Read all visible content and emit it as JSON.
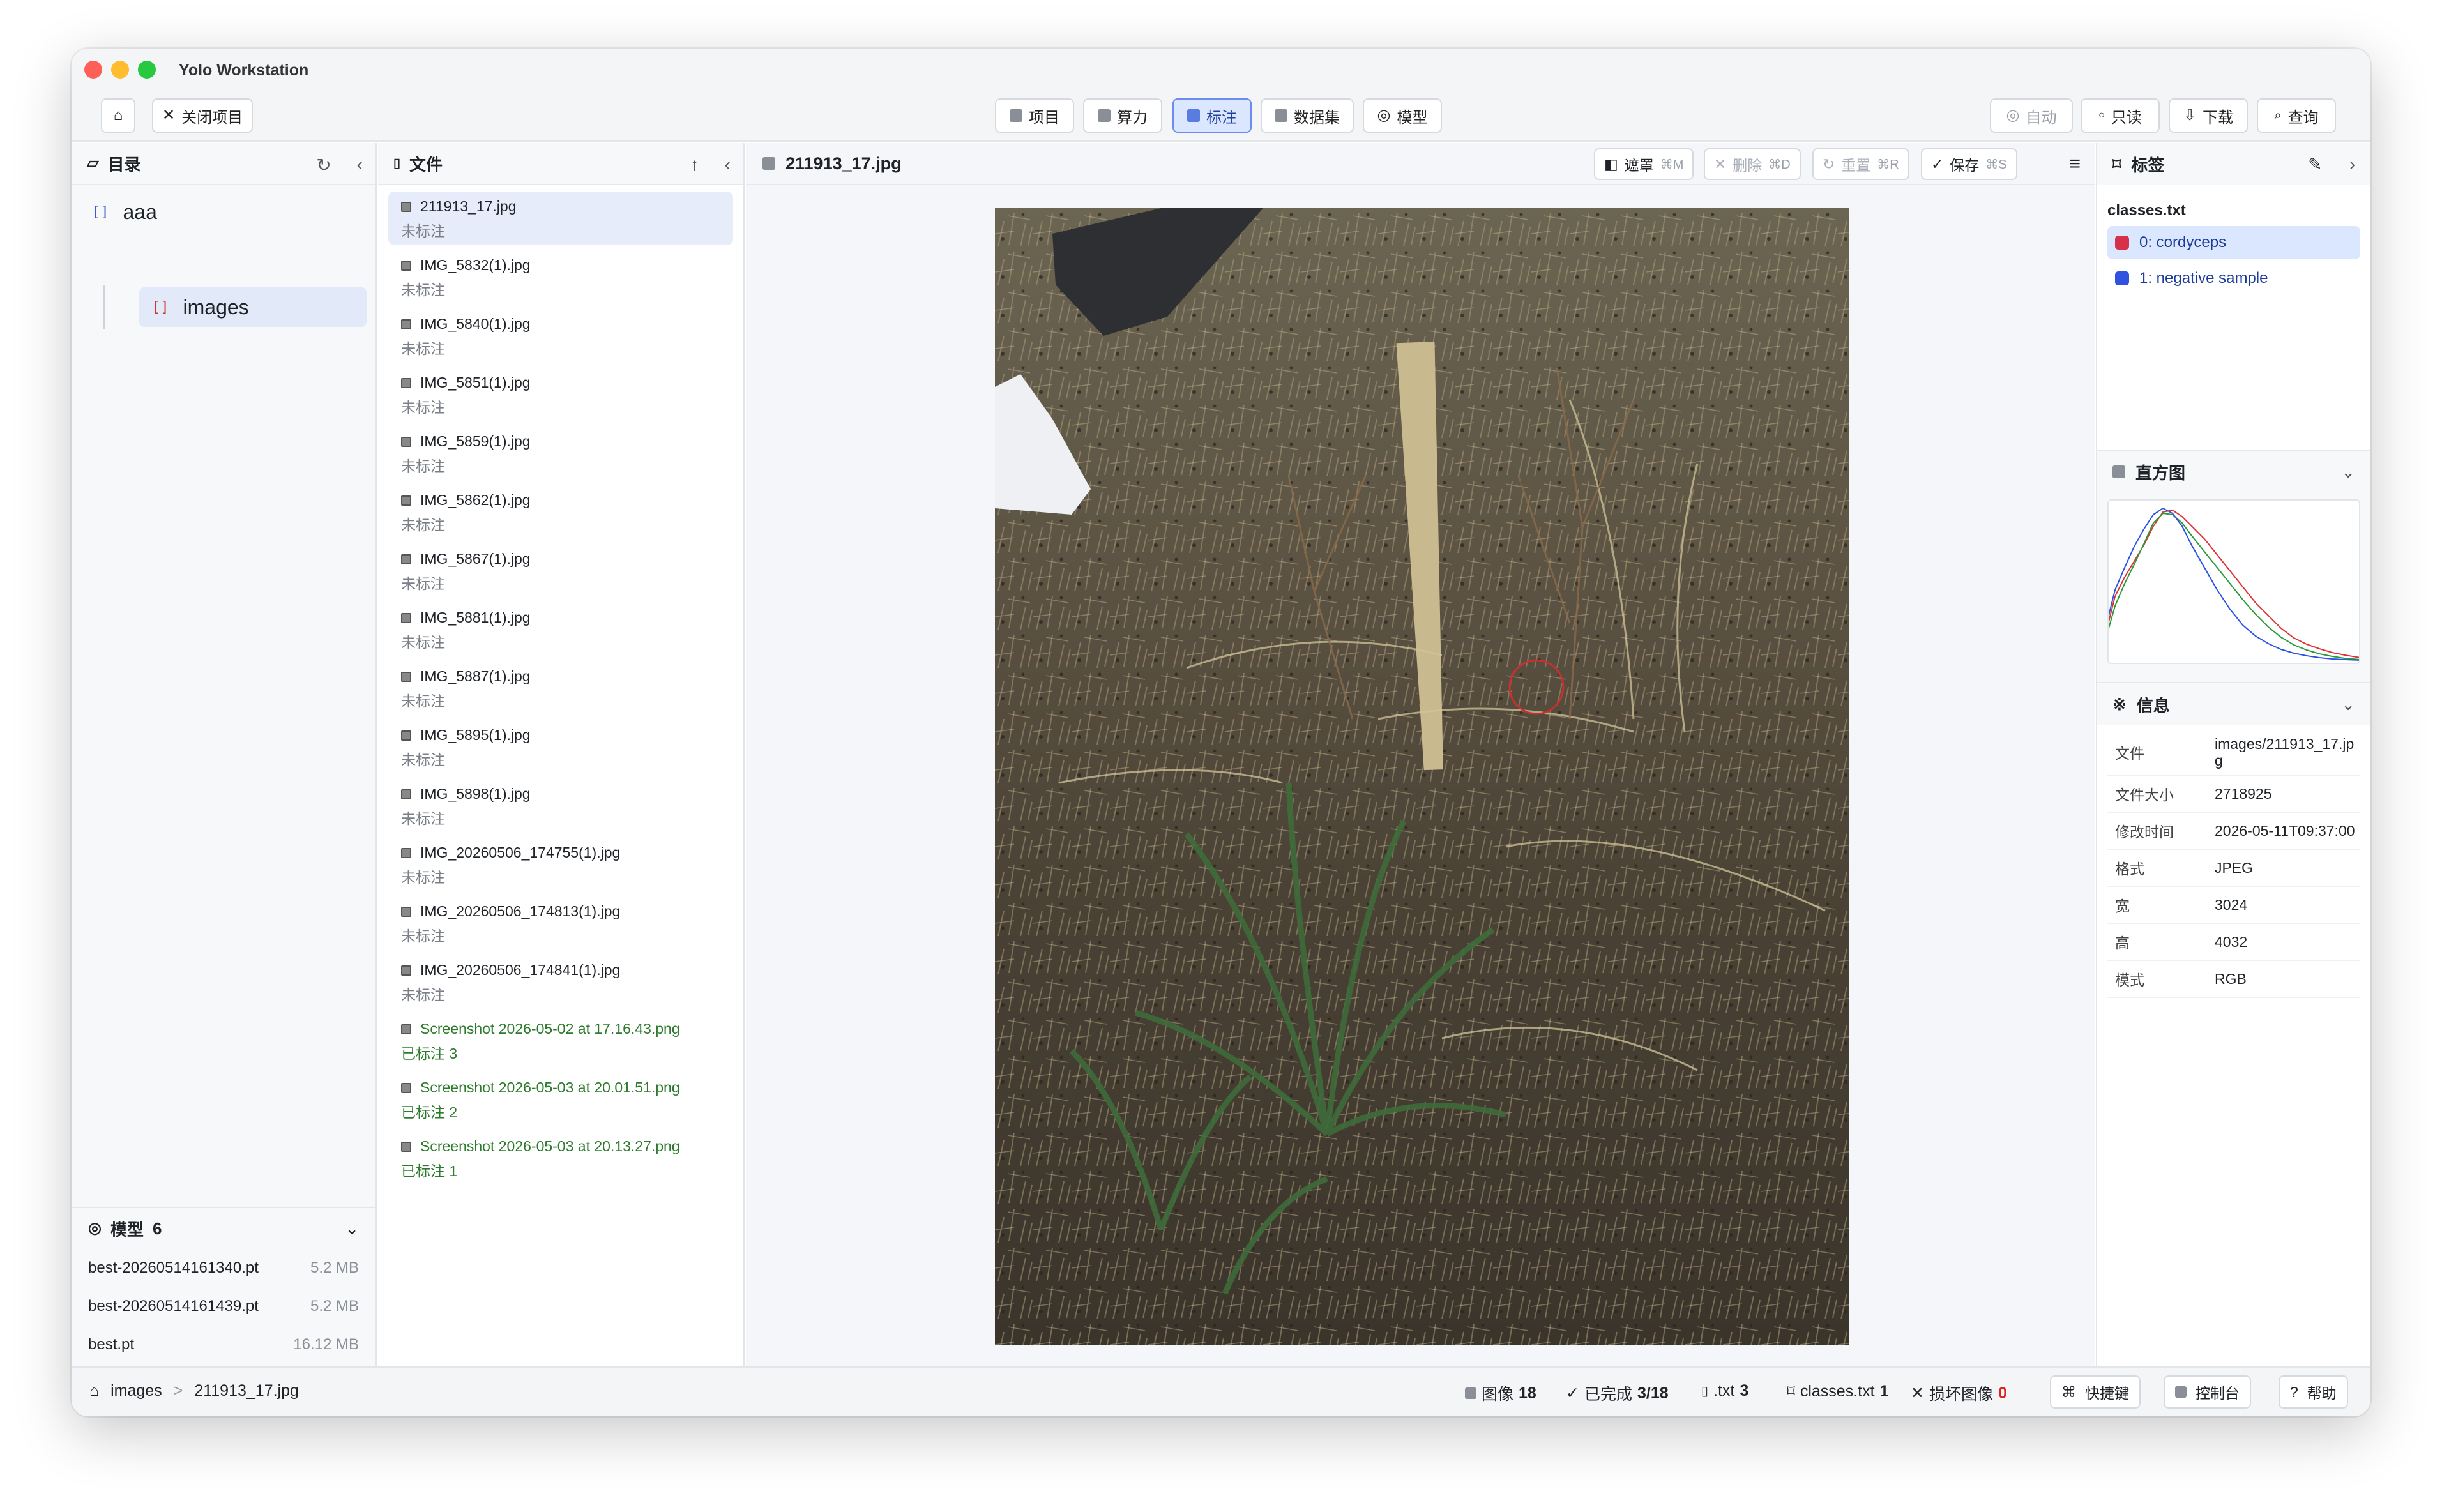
{
  "app": {
    "title": "Yolo Workstation"
  },
  "toolbar": {
    "close_project": "关闭项目",
    "tabs": [
      {
        "label": "项目"
      },
      {
        "label": "算力"
      },
      {
        "label": "标注"
      },
      {
        "label": "数据集"
      },
      {
        "label": "模型"
      }
    ],
    "auto": "自动",
    "readonly": "只读",
    "download": "下载",
    "query": "查询"
  },
  "directory": {
    "title": "目录",
    "root": "aaa",
    "child": "images"
  },
  "models": {
    "title": "模型",
    "count": "6",
    "items": [
      {
        "name": "best-20260514161340.pt",
        "size": "5.2 MB"
      },
      {
        "name": "best-20260514161439.pt",
        "size": "5.2 MB"
      },
      {
        "name": "best.pt",
        "size": "16.12 MB"
      }
    ]
  },
  "files": {
    "title": "文件",
    "items": [
      {
        "name": "211913_17.jpg",
        "status": "未标注"
      },
      {
        "name": "IMG_5832(1).jpg",
        "status": "未标注"
      },
      {
        "name": "IMG_5840(1).jpg",
        "status": "未标注"
      },
      {
        "name": "IMG_5851(1).jpg",
        "status": "未标注"
      },
      {
        "name": "IMG_5859(1).jpg",
        "status": "未标注"
      },
      {
        "name": "IMG_5862(1).jpg",
        "status": "未标注"
      },
      {
        "name": "IMG_5867(1).jpg",
        "status": "未标注"
      },
      {
        "name": "IMG_5881(1).jpg",
        "status": "未标注"
      },
      {
        "name": "IMG_5887(1).jpg",
        "status": "未标注"
      },
      {
        "name": "IMG_5895(1).jpg",
        "status": "未标注"
      },
      {
        "name": "IMG_5898(1).jpg",
        "status": "未标注"
      },
      {
        "name": "IMG_20260506_174755(1).jpg",
        "status": "未标注"
      },
      {
        "name": "IMG_20260506_174813(1).jpg",
        "status": "未标注"
      },
      {
        "name": "IMG_20260506_174841(1).jpg",
        "status": "未标注"
      },
      {
        "name": "Screenshot 2026-05-02 at 17.16.43.png",
        "status": "已标注 3"
      },
      {
        "name": "Screenshot 2026-05-03 at 20.01.51.png",
        "status": "已标注 2"
      },
      {
        "name": "Screenshot 2026-05-03 at 20.13.27.png",
        "status": "已标注 1"
      }
    ]
  },
  "viewer": {
    "filename": "211913_17.jpg",
    "mask": "遮罩",
    "mask_key": "⌘M",
    "delete": "删除",
    "delete_key": "⌘D",
    "reset": "重置",
    "reset_key": "⌘R",
    "save": "保存",
    "save_key": "⌘S"
  },
  "labels": {
    "title": "标签",
    "file": "classes.txt",
    "classes": [
      {
        "label": "0: cordyceps",
        "color": "#d9304a"
      },
      {
        "label": "1: negative sample",
        "color": "#2f52e0"
      }
    ]
  },
  "histogram": {
    "title": "直方图"
  },
  "info": {
    "title": "信息",
    "rows": [
      {
        "key": "文件",
        "value": "images/211913_17.jpg"
      },
      {
        "key": "文件大小",
        "value": "2718925"
      },
      {
        "key": "修改时间",
        "value": "2026-05-11T09:37:00"
      },
      {
        "key": "格式",
        "value": "JPEG"
      },
      {
        "key": "宽",
        "value": "3024"
      },
      {
        "key": "高",
        "value": "4032"
      },
      {
        "key": "模式",
        "value": "RGB"
      }
    ]
  },
  "status": {
    "crumb_root": "images",
    "crumb_file": "211913_17.jpg",
    "images_label": "图像",
    "images_value": "18",
    "done_label": "已完成",
    "done_value": "3/18",
    "txt_label": ".txt",
    "txt_value": "3",
    "classes_label": "classes.txt",
    "classes_value": "1",
    "broken_label": "损坏图像",
    "broken_value": "0",
    "shortcuts": "快捷键",
    "console": "控制台",
    "help": "帮助"
  }
}
